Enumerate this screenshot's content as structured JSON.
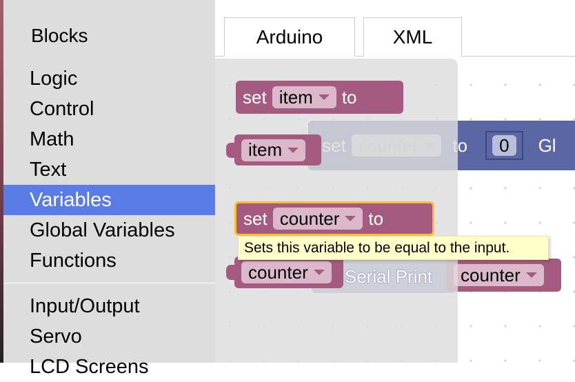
{
  "sidebar": {
    "header": "Blocks",
    "categories": [
      "Logic",
      "Control",
      "Math",
      "Text",
      "Variables",
      "Global Variables",
      "Functions"
    ],
    "categories2": [
      "Input/Output",
      "Servo",
      "LCD Screens"
    ],
    "selected": "Variables"
  },
  "tabs": [
    "Arduino",
    "XML"
  ],
  "workspace": {
    "global_block": {
      "set": "set",
      "var": "counter",
      "to": "to",
      "value": "0",
      "suffix": "Gl"
    },
    "serial_print": "Serial Print",
    "counter_var": "counter"
  },
  "flyout": {
    "set_item": {
      "set": "set",
      "var": "item",
      "to": "to"
    },
    "item_get": "item",
    "set_counter": {
      "set": "set",
      "var": "counter",
      "to": "to"
    },
    "counter_get": "counter"
  },
  "tooltip": "Sets this variable to be equal to the input.",
  "colors": {
    "variables": "#a55b80",
    "selected_category": "#5a7ce6",
    "global": "#5b67a5",
    "highlight": "#fbc02d"
  }
}
